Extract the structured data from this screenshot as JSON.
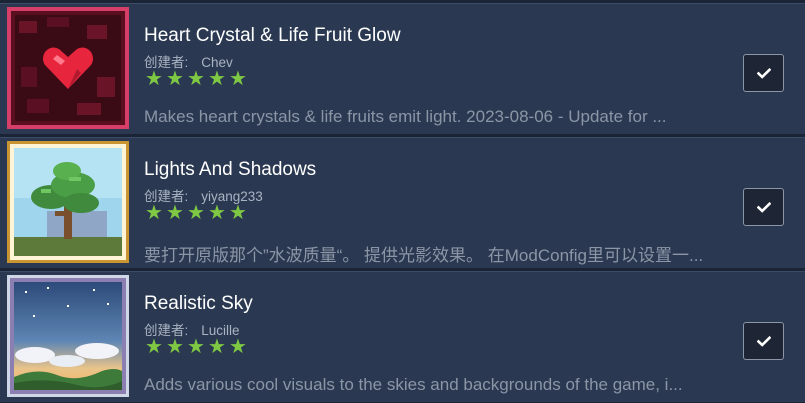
{
  "items": [
    {
      "title": "Heart Crystal & Life Fruit Glow",
      "author_label": "创建者:",
      "author": "Chev",
      "rating_stars": 5,
      "description": "Makes heart crystals & life fruits emit light. 2023-08-06 - Update for ...",
      "subscribed": true,
      "thumbnail_icon": "heart-crystal-icon"
    },
    {
      "title": "Lights And Shadows",
      "author_label": "创建者:",
      "author": "yiyang233",
      "rating_stars": 5,
      "description": "要打开原版那个”水波质量“。 提供光影效果。 在ModConfig里可以设置一...",
      "subscribed": true,
      "thumbnail_icon": "tree-icon"
    },
    {
      "title": "Realistic Sky",
      "author_label": "创建者:",
      "author": "Lucille",
      "rating_stars": 5,
      "description": "Adds various cool visuals to the skies and backgrounds of the game, i...",
      "subscribed": true,
      "thumbnail_icon": "sky-icon"
    }
  ],
  "colors": {
    "background": "#1b2434",
    "row": "#2a3951",
    "star": "#7ec843",
    "title": "#ffffff",
    "description": "#8b95a6"
  }
}
